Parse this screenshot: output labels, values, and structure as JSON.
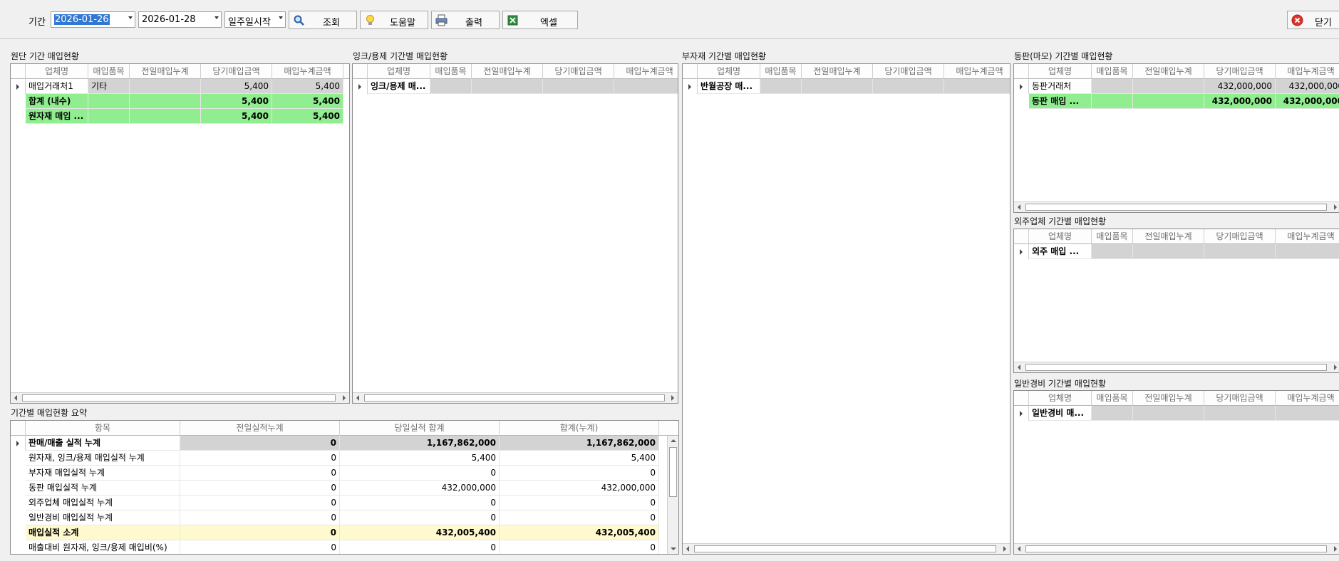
{
  "toolbar": {
    "period_label": "기간",
    "date_from": "2026-01-26",
    "date_to": "2026-01-28",
    "week_start": "일주일시작",
    "search_label": "조회",
    "help_label": "도움말",
    "print_label": "출력",
    "excel_label": "엑셀",
    "close_label": "닫기"
  },
  "columns": [
    "업체명",
    "매입품목",
    "전일매입누계",
    "당기매입금액",
    "매입누계금액"
  ],
  "fabric": {
    "title": "원단 기간 매입현황",
    "rows": [
      [
        "매입거래처1",
        "기타",
        "",
        "5,400",
        "5,400"
      ],
      [
        "합계 (내수)",
        "",
        "",
        "5,400",
        "5,400"
      ],
      [
        "원자재 매입 ...",
        "",
        "",
        "5,400",
        "5,400"
      ]
    ]
  },
  "ink": {
    "title": "잉크/용제 기간별 매입현황",
    "rows": [
      [
        "잉크/용제 매...",
        "",
        "",
        "",
        ""
      ]
    ]
  },
  "submat": {
    "title": "부자재 기간별 매입현황",
    "rows": [
      [
        "반월공장 매...",
        "",
        "",
        "",
        ""
      ]
    ]
  },
  "copper": {
    "title": "동판(마모) 기간별 매입현황",
    "rows": [
      [
        "동판거래처",
        "",
        "",
        "432,000,000",
        "432,000,000"
      ],
      [
        "동판 매입 ...",
        "",
        "",
        "432,000,000",
        "432,000,000"
      ]
    ]
  },
  "outsource": {
    "title": "외주업체 기간별 매입현황",
    "rows": [
      [
        "외주 매입 ...",
        "",
        "",
        "",
        ""
      ]
    ]
  },
  "general": {
    "title": "일반경비 기간별 매입현황",
    "rows": [
      [
        "일반경비 매...",
        "",
        "",
        "",
        ""
      ]
    ]
  },
  "summary": {
    "title": "기간별 매입현황 요약",
    "columns": [
      "항목",
      "전일실적누계",
      "당일실적 합계",
      "합계(누계)"
    ],
    "rows": [
      [
        "판매/매출 실적 누계",
        "0",
        "1,167,862,000",
        "1,167,862,000"
      ],
      [
        "원자재, 잉크/용제 매입실적 누계",
        "0",
        "5,400",
        "5,400"
      ],
      [
        "부자재 매입실적 누계",
        "0",
        "0",
        "0"
      ],
      [
        "동판 매입실적 누계",
        "0",
        "432,000,000",
        "432,000,000"
      ],
      [
        "외주업체 매입실적 누계",
        "0",
        "0",
        "0"
      ],
      [
        "일반경비 매입실적 누계",
        "0",
        "0",
        "0"
      ],
      [
        "매입실적 소계",
        "0",
        "432,005,400",
        "432,005,400"
      ],
      [
        "매출대비 원자재, 잉크/용제 매입비(%)",
        "0",
        "0",
        "0"
      ]
    ]
  },
  "colors": {
    "row_green": "#90ee90",
    "row_yellow": "#fffacd",
    "row_selected": "#d3d3d3"
  },
  "icons": {
    "search": "search-icon",
    "help": "bulb-icon",
    "print": "printer-icon",
    "excel": "excel-icon",
    "close": "close-icon"
  }
}
